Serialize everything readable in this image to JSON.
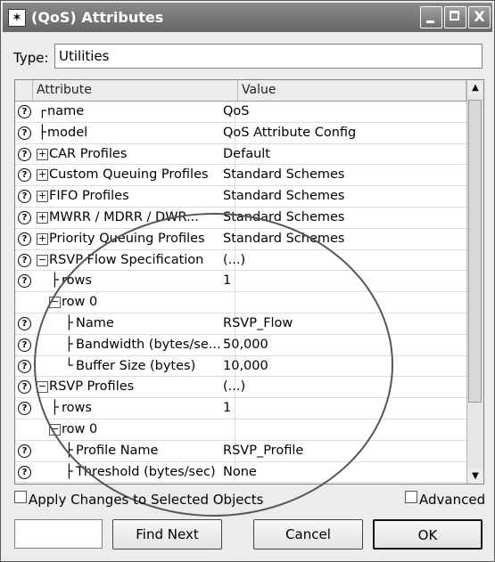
{
  "window": {
    "title": "(QoS) Attributes",
    "title_icon": "star-icon",
    "controls": {
      "minimize": "minimize-icon",
      "maximize": "maximize-icon",
      "close": "X"
    }
  },
  "type_field": {
    "label": "Type:",
    "value": "Utilities"
  },
  "grid": {
    "headers": {
      "attribute": "Attribute",
      "value": "Value"
    },
    "rows": [
      {
        "prefix": "┌",
        "name": "name",
        "value": "QoS",
        "expander": ""
      },
      {
        "prefix": "├",
        "name": "model",
        "value": "QoS Attribute Config",
        "expander": ""
      },
      {
        "prefix": "",
        "name": "CAR Profiles",
        "value": "Default",
        "expander": "+"
      },
      {
        "prefix": "",
        "name": "Custom Queuing Profiles",
        "value": "Standard Schemes",
        "expander": "+"
      },
      {
        "prefix": "",
        "name": "FIFO Profiles",
        "value": "Standard Schemes",
        "expander": "+"
      },
      {
        "prefix": "",
        "name": "MWRR / MDRR / DWR...",
        "value": "Standard Schemes",
        "expander": "+"
      },
      {
        "prefix": "",
        "name": "Priority Queuing Profiles",
        "value": "Standard Schemes",
        "expander": "+"
      },
      {
        "prefix": "",
        "name": "RSVP Flow Specification",
        "value": "(...)",
        "expander": "−"
      },
      {
        "prefix": "├",
        "name": "rows",
        "value": "1",
        "expander": ""
      },
      {
        "prefix": "",
        "name": "row 0",
        "value": "",
        "expander": "−"
      },
      {
        "prefix": "├",
        "name": "Name",
        "value": "RSVP_Flow",
        "expander": ""
      },
      {
        "prefix": "├",
        "name": "Bandwidth (bytes/se...",
        "value": "50,000",
        "expander": ""
      },
      {
        "prefix": "└",
        "name": "Buffer Size (bytes)",
        "value": "10,000",
        "expander": ""
      },
      {
        "prefix": "",
        "name": "RSVP Profiles",
        "value": "(...)",
        "expander": "−"
      },
      {
        "prefix": "├",
        "name": "rows",
        "value": "1",
        "expander": ""
      },
      {
        "prefix": "",
        "name": "row 0",
        "value": "",
        "expander": "−"
      },
      {
        "prefix": "├",
        "name": "Profile Name",
        "value": "RSVP_Profile",
        "expander": ""
      },
      {
        "prefix": "├",
        "name": "Threshold (bytes/sec)",
        "value": "None",
        "expander": ""
      }
    ]
  },
  "checkboxes": {
    "apply_changes": {
      "label": "Apply Changes to Selected Objects",
      "checked": false
    },
    "advanced": {
      "label": "Advanced",
      "checked": false
    }
  },
  "buttons": {
    "find_next": "Find Next",
    "cancel": "Cancel",
    "ok": "OK"
  }
}
